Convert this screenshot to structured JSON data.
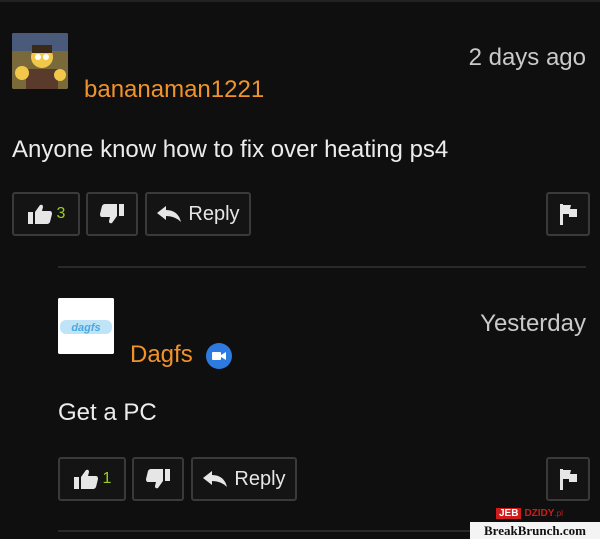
{
  "comments": [
    {
      "username": "bananaman1221",
      "timestamp": "2 days ago",
      "text": "Anyone know how to fix over heating ps4",
      "likes": "3",
      "reply_label": "Reply",
      "avatar": "cartoon-avatar"
    },
    {
      "username": "Dagfs",
      "timestamp": "Yesterday",
      "text": "Get a PC",
      "likes": "1",
      "reply_label": "Reply",
      "avatar_text": "dagfs",
      "badge_icon": "video-camera-icon"
    }
  ],
  "watermark": {
    "jeb": "JEB",
    "brand": "DZIDY",
    "suffix": ".pl",
    "site": "BreakBrunch.com"
  },
  "colors": {
    "background": "#0f0f0f",
    "username": "#f0932b",
    "like_count": "#9bcf1e",
    "badge": "#2d7be0"
  }
}
